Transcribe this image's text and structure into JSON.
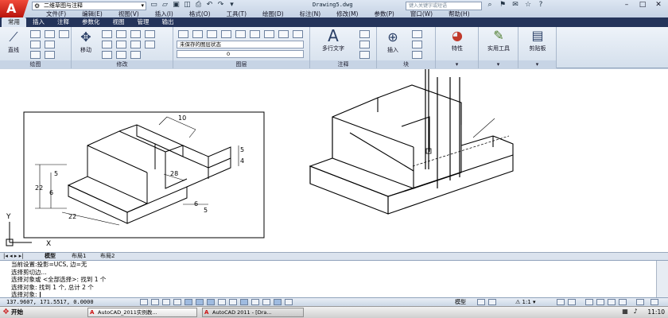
{
  "titlebar": {
    "workspace": "二维草图与注释",
    "doc_title": "Drawing5.dwg",
    "search_placeholder": "键入关键字或短语"
  },
  "menubar": [
    "文件(F)",
    "编辑(E)",
    "视图(V)",
    "插入(I)",
    "格式(O)",
    "工具(T)",
    "绘图(D)",
    "标注(N)",
    "修改(M)",
    "参数(P)",
    "窗口(W)",
    "帮助(H)"
  ],
  "ribbon_tabs": [
    "常用",
    "插入",
    "注释",
    "参数化",
    "视图",
    "管理",
    "输出"
  ],
  "ribbon": {
    "draw_panel": {
      "title": "绘图",
      "line_label": "直线"
    },
    "modify_panel": {
      "title": "修改",
      "move_label": "移动"
    },
    "layers_panel": {
      "title": "图层",
      "layer_state": "未保存的图层状态",
      "layer_current": "0"
    },
    "annotation_panel": {
      "title": "注释",
      "mtext_label": "多行文字"
    },
    "block_panel": {
      "title": "块",
      "insert_label": "插入"
    },
    "properties_label": "特性",
    "utilities_label": "实用工具",
    "clipboard_label": "剪贴板"
  },
  "drawing": {
    "dims": [
      "10",
      "28",
      "5",
      "22",
      "6",
      "6",
      "5",
      "4",
      "22",
      "5"
    ],
    "ucs_y": "Y",
    "ucs_x": "X"
  },
  "layout_tabs": [
    "模型",
    "布局1",
    "布局2"
  ],
  "command_lines": [
    "当前设置:投影=UCS, 边=无",
    "选择剪切边...",
    "选择对象或 <全部选择>:  找到 1 个",
    "选择对象: 找到 1 个, 总计 2 个",
    "选择对象:"
  ],
  "status": {
    "coords": "137.9607, 171.5517, 0.0000",
    "model_label": "模型",
    "scale": "1:1"
  },
  "taskbar": {
    "start": "开始",
    "apps": [
      "AutoCAD_2011实例教...",
      "AutoCAD 2011 - [Dra..."
    ],
    "clock": "11:10"
  }
}
